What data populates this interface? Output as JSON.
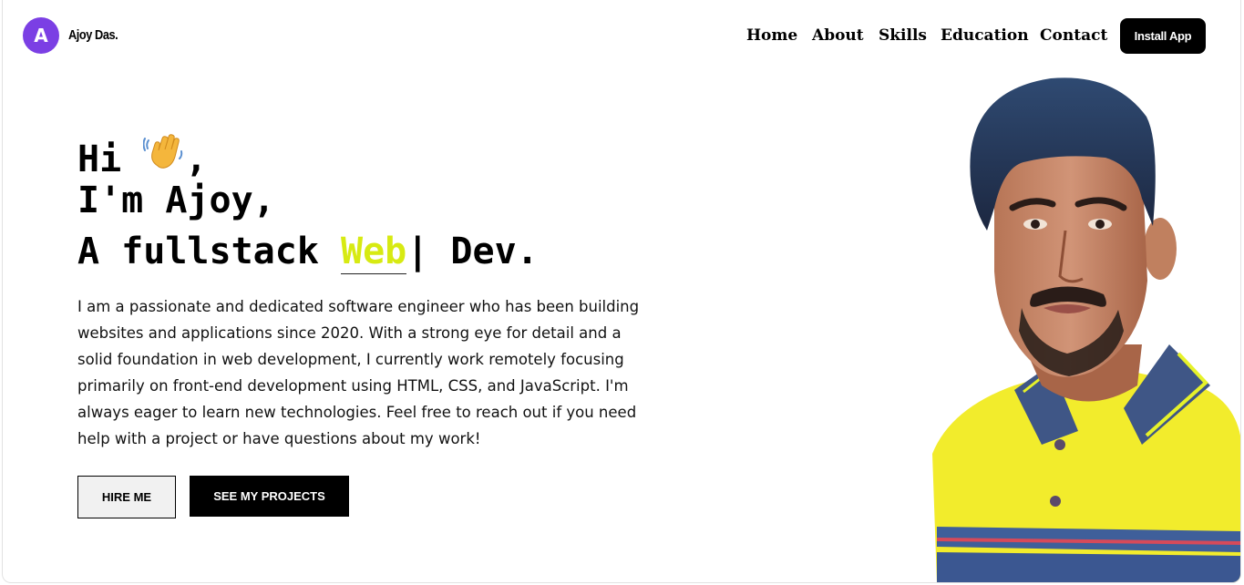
{
  "header": {
    "logo_letter": "A",
    "logo_name": "Ajoy Das.",
    "nav": [
      "Home",
      "About",
      "Skills",
      "Education",
      "Contact"
    ],
    "install_label": "Install App"
  },
  "hero": {
    "greeting": "Hi",
    "greeting_suffix": ",",
    "wave_icon": "waving-hand-icon",
    "line2": "I'm Ajoy,",
    "line3_prefix": "A fullstack",
    "typed_word": "Web",
    "line3_suffix": "| Dev.",
    "description": "I am a passionate and dedicated software engineer who has been building websites and applications since 2020. With a strong eye for detail and a solid foundation in web development, I currently work remotely focusing primarily on front-end development using HTML, CSS, and JavaScript. I'm always eager to learn new technologies. Feel free to reach out if you need help with a project or have questions about my work!",
    "hire_label": "HIRE ME",
    "projects_label": "SEE MY PROJECTS"
  },
  "colors": {
    "logo": "#7b3fe4",
    "accent": "#d7ea12",
    "button_dark": "#000000"
  }
}
